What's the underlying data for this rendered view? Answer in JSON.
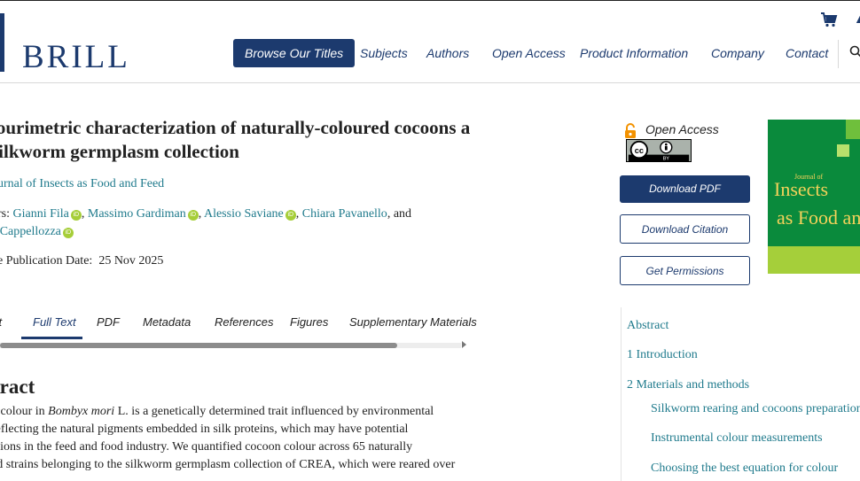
{
  "header": {
    "logo": "BRILL",
    "nav": [
      {
        "label": "Browse Our Titles",
        "active": true
      },
      {
        "label": "Subjects"
      },
      {
        "label": "Authors"
      },
      {
        "label": "Open Access"
      },
      {
        "label": "Product Information"
      },
      {
        "label": "Company"
      },
      {
        "label": "Contact"
      }
    ],
    "icons": [
      "cart-icon",
      "search-icon"
    ]
  },
  "article": {
    "title": "lourimetric characterization of naturally-coloured cocoons a silkworm germplasm collection",
    "journal": "ournal of Insects as Food and Feed",
    "authors_prefix": "ors:",
    "authors": [
      "Gianni Fila",
      "Massimo Gardiman",
      "Alessio Saviane",
      "Chiara Pavanello",
      "a Cappellozza"
    ],
    "authors_conjunction": "and",
    "pubdate_label": "ne Publication Date:",
    "pubdate_value": "25 Nov 2025"
  },
  "tabs": [
    {
      "label": "ct"
    },
    {
      "label": "Full Text",
      "active": true
    },
    {
      "label": "PDF"
    },
    {
      "label": "Metadata"
    },
    {
      "label": "References"
    },
    {
      "label": "Figures"
    },
    {
      "label": "Supplementary Materials"
    }
  ],
  "abstract": {
    "heading": "tract",
    "lines": [
      "n colour in Bombyx mori L. is a genetically determined trait influenced by environmental",
      " reflecting the natural pigments embedded in silk proteins, which may have potential",
      "ations in the feed and food industry. We quantified cocoon colour across 65 naturally",
      "ed strains belonging to the silkworm germplasm collection of CREA, which were reared over"
    ]
  },
  "sidebar": {
    "open_access_label": "Open Access",
    "license_badge": "CC BY",
    "download_pdf": "Download PDF",
    "download_citation": "Download Citation",
    "get_permissions": "Get Permissions",
    "cover": {
      "small": "Journal of",
      "line1": "Insects",
      "line2": "as Food and Fee"
    },
    "toc": [
      {
        "label": "Abstract",
        "level": 1
      },
      {
        "label": "1 Introduction",
        "level": 1
      },
      {
        "label": "2 Materials and methods",
        "level": 1
      },
      {
        "label": "Silkworm rearing and cocoons preparation",
        "level": 2
      },
      {
        "label": "Instrumental colour measurements",
        "level": 2
      },
      {
        "label": "Choosing the best equation for colour",
        "level": 2
      }
    ]
  },
  "colors": {
    "brand": "#1c3a6e",
    "link": "#1f7a8c",
    "orcid": "#a6ce39",
    "open_access": "#f39200"
  }
}
